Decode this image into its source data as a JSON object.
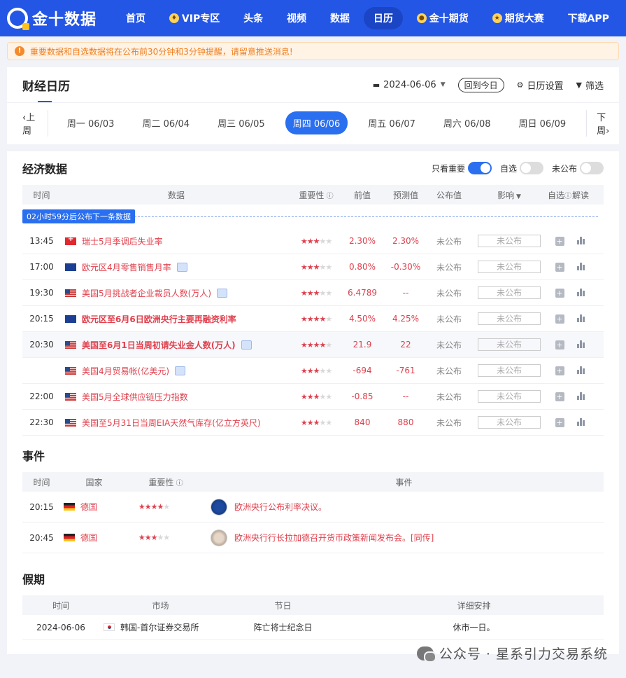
{
  "brand": {
    "logo_text": "金十数据"
  },
  "nav": [
    {
      "label": "首页",
      "icon": ""
    },
    {
      "label": "VIP专区",
      "icon": "vip-icon"
    },
    {
      "label": "头条",
      "icon": ""
    },
    {
      "label": "视频",
      "icon": ""
    },
    {
      "label": "数据",
      "icon": ""
    },
    {
      "label": "日历",
      "icon": "",
      "active": true
    },
    {
      "label": "金十期货",
      "icon": "futures-icon"
    },
    {
      "label": "期货大赛",
      "icon": "contest-icon"
    },
    {
      "label": "下载APP",
      "icon": ""
    }
  ],
  "notice": {
    "icon": "!",
    "text": "重要数据和自选数据将在公布前30分钟和3分钟提醒，请留意推送消息!"
  },
  "calendar": {
    "title": "财经日历",
    "date": "2024-06-06",
    "today_btn": "回到今日",
    "settings": "日历设置",
    "filter": "筛选",
    "prev": "上周",
    "next": "下周",
    "days": [
      "周一 06/03",
      "周二 06/04",
      "周三 06/05",
      "周四 06/06",
      "周五 06/07",
      "周六 06/08",
      "周日 06/09"
    ]
  },
  "econ": {
    "title": "经济数据",
    "toggles": [
      "只看重要",
      "自选",
      "未公布"
    ],
    "headers": {
      "time": "时间",
      "data": "数据",
      "importance": "重要性",
      "prev": "前值",
      "forecast": "预测值",
      "published": "公布值",
      "effect": "影响",
      "fav": "自选",
      "interpret": "解读"
    },
    "countdown": "02小时59分后公布下一条数据",
    "rows": [
      {
        "time": "13:45",
        "flag": "f-ch",
        "name": "瑞士5月季调后失业率",
        "doc": false,
        "bold": false,
        "stars": "★★★★★",
        "prev": "2.30%",
        "forecast": "2.30%",
        "published": "未公布",
        "effect": "未公布"
      },
      {
        "time": "17:00",
        "flag": "f-eu",
        "name": "欧元区4月零售销售月率",
        "doc": true,
        "bold": false,
        "stars": "★★★★★",
        "prev": "0.80%",
        "forecast": "-0.30%",
        "published": "未公布",
        "effect": "未公布"
      },
      {
        "time": "19:30",
        "flag": "f-us",
        "name": "美国5月挑战者企业裁员人数(万人)",
        "doc": true,
        "bold": false,
        "stars": "★★★★★",
        "prev": "6.4789",
        "forecast": "--",
        "published": "未公布",
        "effect": "未公布"
      },
      {
        "time": "20:15",
        "flag": "f-eu",
        "name": "欧元区至6月6日欧洲央行主要再融资利率",
        "doc": false,
        "bold": true,
        "stars": "★★★★★",
        "prev": "4.50%",
        "forecast": "4.25%",
        "published": "未公布",
        "effect": "未公布"
      },
      {
        "time": "20:30",
        "flag": "f-us",
        "name": "美国至6月1日当周初请失业金人数(万人)",
        "doc": true,
        "bold": true,
        "stars": "★★★★★",
        "prev": "21.9",
        "forecast": "22",
        "published": "未公布",
        "effect": "未公布"
      },
      {
        "time": "",
        "flag": "f-us",
        "name": "美国4月贸易帐(亿美元)",
        "doc": true,
        "bold": false,
        "stars": "★★★★★",
        "prev": "-694",
        "forecast": "-761",
        "published": "未公布",
        "effect": "未公布"
      },
      {
        "time": "22:00",
        "flag": "f-us",
        "name": "美国5月全球供应链压力指数",
        "doc": false,
        "bold": false,
        "stars": "★★★★★",
        "prev": "-0.85",
        "forecast": "--",
        "published": "未公布",
        "effect": "未公布"
      },
      {
        "time": "22:30",
        "flag": "f-us",
        "name": "美国至5月31日当周EIA天然气库存(亿立方英尺)",
        "doc": false,
        "bold": false,
        "stars": "★★★★★",
        "prev": "840",
        "forecast": "880",
        "published": "未公布",
        "effect": "未公布"
      }
    ],
    "importance_levels": [
      3,
      3,
      3,
      4,
      4,
      3,
      3,
      3
    ]
  },
  "events": {
    "title": "事件",
    "headers": {
      "time": "时间",
      "country": "国家",
      "importance": "重要性",
      "event": "事件"
    },
    "rows": [
      {
        "time": "20:15",
        "flag": "f-de",
        "country": "德国",
        "stars": "★★★★★",
        "avatar": "av1",
        "text": "欧洲央行公布利率决议。"
      },
      {
        "time": "20:45",
        "flag": "f-de",
        "country": "德国",
        "stars": "★★★★★",
        "avatar": "av2",
        "text": "欧洲央行行长拉加德召开货币政策新闻发布会。[同传]"
      }
    ],
    "importance_levels": [
      4,
      3
    ]
  },
  "holidays": {
    "title": "假期",
    "headers": {
      "time": "时间",
      "market": "市场",
      "holiday": "节日",
      "detail": "详细安排"
    },
    "rows": [
      {
        "time": "2024-06-06",
        "flag": "f-kr",
        "market": "韩国-首尔证券交易所",
        "holiday": "阵亡将士纪念日",
        "detail": "休市一日。"
      }
    ]
  },
  "watermark": "公众号 · 星系引力交易系统",
  "colors": {
    "brand": "#2456e6",
    "accent": "#e0404d",
    "active_day": "#2a6ff0"
  }
}
